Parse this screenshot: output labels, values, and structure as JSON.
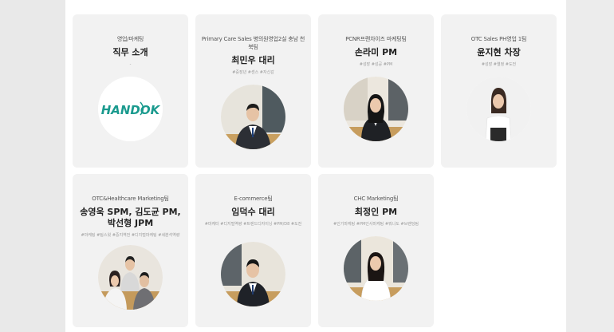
{
  "cards": [
    {
      "dept": "영업/마케팅",
      "name": "직무 소개",
      "tags": "-",
      "logo": "HANDOK"
    },
    {
      "dept": "Primary Care Sales 병의원영업2실 충남 천북팀",
      "name": "최민우 대리",
      "tags": "#중장년 #센스 #자신감"
    },
    {
      "dept": "PCNR프랜차이즈 마케팅팀",
      "name": "손라미 PM",
      "tags": "#성장 #성공 #PM"
    },
    {
      "dept": "OTC Sales PH영업 1팀",
      "name": "윤지현 차장",
      "tags": "#성장 #열정 #도전"
    },
    {
      "dept": "OTC&Healthcare Marketing팀",
      "name": "송영욱 SPM, 김도균 PM, 박선형 JPM",
      "tags": "#마케팅 #팀스윗 #중지역전 #디지털마케팅 #세분석역량"
    },
    {
      "dept": "E-commerce팀",
      "name": "임덕수 대리",
      "tags": "#마케터 #디지털역량 #트렌드디자이닝 #PM/D8 #도전"
    },
    {
      "dept": "CHC Marketing팀",
      "name": "최정인 PM",
      "tags": "#인기마케팅 #PM인사마케팅 #뭐나도 #브랜딩팀"
    }
  ]
}
